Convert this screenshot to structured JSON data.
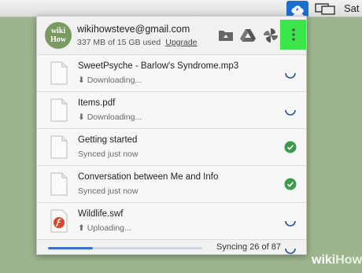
{
  "menubar": {
    "day_label": "Sat",
    "icons": [
      "google-drive-icon",
      "display-icon"
    ]
  },
  "account": {
    "avatar_text": [
      "wiki",
      "How"
    ],
    "email": "wikihowsteve@gmail.com",
    "storage": "337 MB of 15 GB used",
    "upgrade_label": "Upgrade"
  },
  "header_icons": [
    "folder-icon",
    "drive-icon",
    "photos-icon",
    "more-vert-icon"
  ],
  "files": [
    {
      "name": "SweetPsyche - Barlow's Syndrome.mp3",
      "status": "Downloading...",
      "state": "syncing",
      "icon": "document-icon"
    },
    {
      "name": "Items.pdf",
      "status": "Downloading...",
      "state": "syncing",
      "icon": "document-icon"
    },
    {
      "name": "Getting started",
      "status": "Synced just now",
      "state": "synced",
      "icon": "document-icon"
    },
    {
      "name": "Conversation between Me and Info",
      "status": "Synced just now",
      "state": "synced",
      "icon": "document-icon"
    },
    {
      "name": "Wildlife.swf",
      "status": "Uploading...",
      "state": "syncing",
      "icon": "flash-file-icon"
    }
  ],
  "footer": {
    "sync_text": "Syncing 26 of 87",
    "progress_fraction": 0.29
  },
  "watermark": {
    "part1": "wiki",
    "part2": "How"
  },
  "colors": {
    "accent": "#3c6fce",
    "highlight": "#3ae64a",
    "synced": "#3a9a4a",
    "background": "#9db58e"
  }
}
